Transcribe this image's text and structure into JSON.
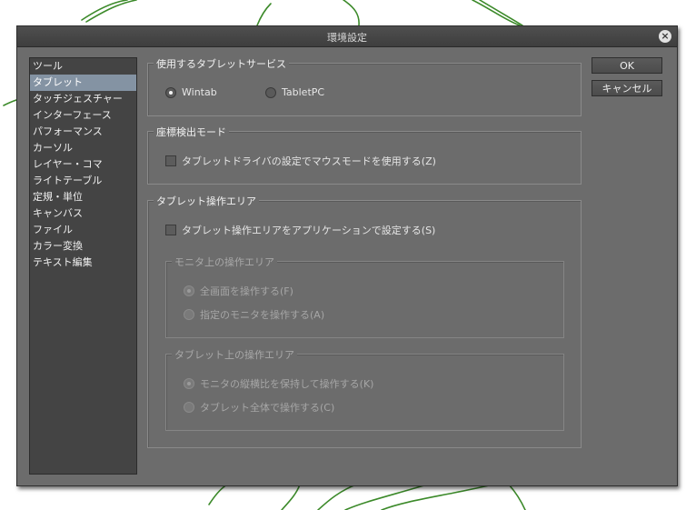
{
  "window": {
    "title": "環境設定",
    "close_icon": "×"
  },
  "sidebar": {
    "items": [
      {
        "label": "ツール"
      },
      {
        "label": "タブレット",
        "selected": true
      },
      {
        "label": "タッチジェスチャー"
      },
      {
        "label": "インターフェース"
      },
      {
        "label": "パフォーマンス"
      },
      {
        "label": "カーソル"
      },
      {
        "label": "レイヤー・コマ"
      },
      {
        "label": "ライトテーブル"
      },
      {
        "label": "定規・単位"
      },
      {
        "label": "キャンバス"
      },
      {
        "label": "ファイル"
      },
      {
        "label": "カラー変換"
      },
      {
        "label": "テキスト編集"
      }
    ]
  },
  "tablet_service": {
    "title": "使用するタブレットサービス",
    "wintab_label": "Wintab",
    "tabletpc_label": "TabletPC",
    "selected": "Wintab"
  },
  "coordinate_mode": {
    "title": "座標検出モード",
    "mouse_mode_label": "タブレットドライバの設定でマウスモードを使用する(Z)",
    "mouse_mode_checked": false
  },
  "operation_area": {
    "title": "タブレット操作エリア",
    "app_setting_label": "タブレット操作エリアをアプリケーションで設定する(S)",
    "app_setting_checked": false,
    "monitor_area": {
      "title": "モニタ上の操作エリア",
      "full_screen_label": "全画面を操作する(F)",
      "specific_monitor_label": "指定のモニタを操作する(A)",
      "selected": "full_screen"
    },
    "tablet_area": {
      "title": "タブレット上の操作エリア",
      "keep_ratio_label": "モニタの縦横比を保持して操作する(K)",
      "whole_tablet_label": "タブレット全体で操作する(C)",
      "selected": "keep_ratio"
    }
  },
  "buttons": {
    "ok": "OK",
    "cancel": "キャンセル"
  },
  "colors": {
    "dialog_bg": "#6c6c6c",
    "titlebar_bg": "#444444",
    "sidebar_bg": "#444444",
    "selection": "#8493a3",
    "scribble": "#3c8a2a"
  }
}
